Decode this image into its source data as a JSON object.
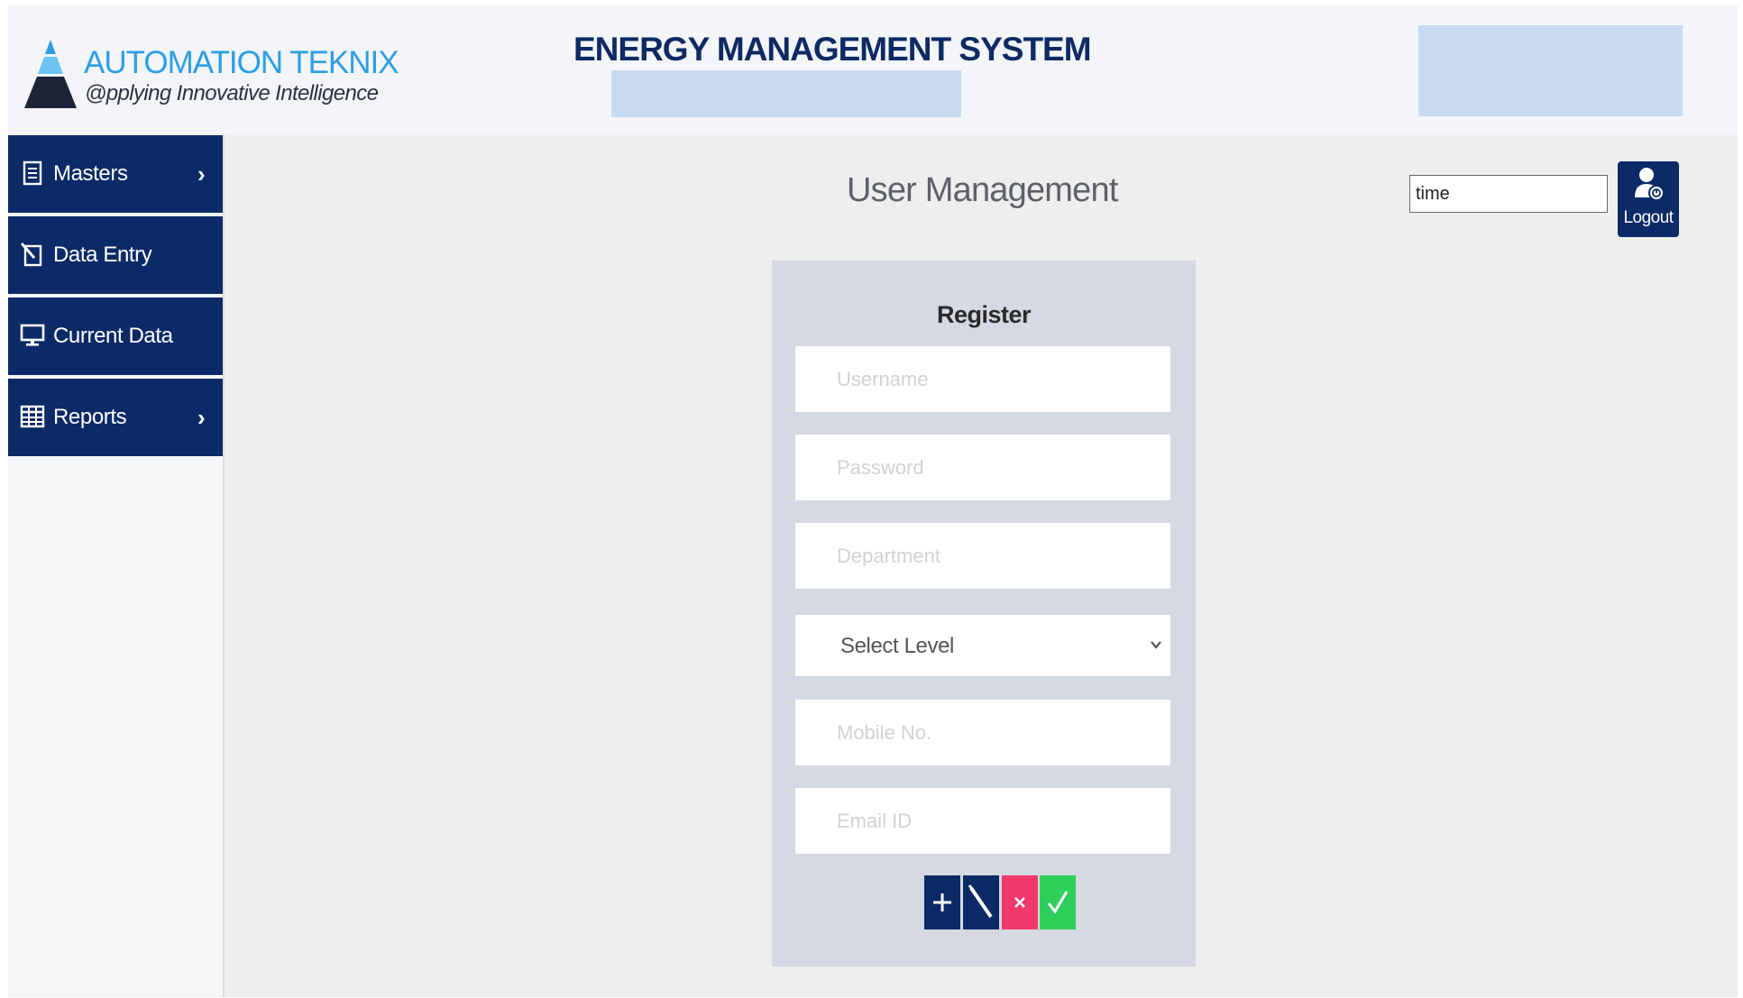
{
  "header": {
    "brand_name": "AUTOMATION TEKNIX",
    "brand_tagline": "@pplying Innovative Intelligence",
    "app_title": "ENERGY MANAGEMENT SYSTEM"
  },
  "sidebar": {
    "items": [
      {
        "label": "Masters",
        "icon": "document-icon",
        "has_submenu": true
      },
      {
        "label": "Data Entry",
        "icon": "edit-icon",
        "has_submenu": false
      },
      {
        "label": "Current Data",
        "icon": "monitor-icon",
        "has_submenu": false
      },
      {
        "label": "Reports",
        "icon": "table-icon",
        "has_submenu": true
      }
    ],
    "chevron": "›"
  },
  "main": {
    "page_title": "User Management",
    "time_field": {
      "value": "time"
    },
    "logout_label": "Logout"
  },
  "register": {
    "title": "Register",
    "fields": {
      "username": {
        "placeholder": "Username"
      },
      "password": {
        "placeholder": "Password"
      },
      "department": {
        "placeholder": "Department"
      },
      "level": {
        "selected": "Select Level"
      },
      "mobile": {
        "placeholder": "Mobile No."
      },
      "email": {
        "placeholder": "Email ID"
      }
    },
    "actions": [
      {
        "name": "add",
        "icon": "plus-icon",
        "color": "#0c2a67"
      },
      {
        "name": "edit",
        "icon": "pencil-icon",
        "color": "#0c2a67"
      },
      {
        "name": "delete",
        "icon": "close-icon",
        "color": "#f0386b"
      },
      {
        "name": "save",
        "icon": "check-icon",
        "color": "#2fd05a"
      }
    ]
  },
  "colors": {
    "navy": "#0c2a67",
    "brand_blue": "#2d9ee5",
    "highlight_box": "#c7daf1",
    "panel": "#d5d9e1"
  }
}
